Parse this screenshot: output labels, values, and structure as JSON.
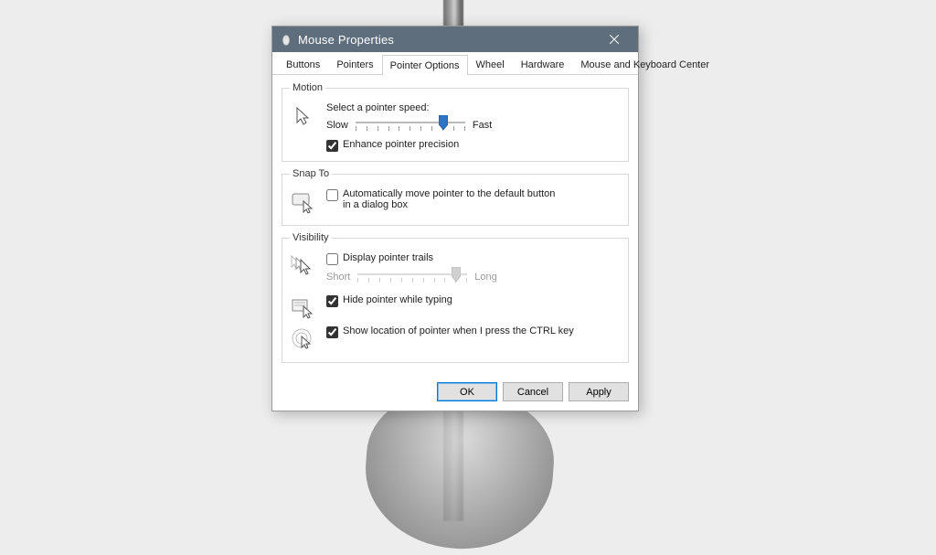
{
  "window": {
    "title": "Mouse Properties"
  },
  "tabs": [
    {
      "label": "Buttons"
    },
    {
      "label": "Pointers"
    },
    {
      "label": "Pointer Options"
    },
    {
      "label": "Wheel"
    },
    {
      "label": "Hardware"
    },
    {
      "label": "Mouse and Keyboard Center"
    }
  ],
  "activeTabIndex": 2,
  "motion": {
    "legend": "Motion",
    "prompt": "Select a pointer speed:",
    "slow": "Slow",
    "fast": "Fast",
    "speed_value": 8,
    "speed_ticks": 11,
    "enhance_label": "Enhance pointer precision",
    "enhance_checked": true
  },
  "snap": {
    "legend": "Snap To",
    "auto_label": "Automatically move pointer to the default button in a dialog box",
    "auto_checked": false
  },
  "visibility": {
    "legend": "Visibility",
    "trails_label": "Display pointer trails",
    "trails_checked": false,
    "short": "Short",
    "long": "Long",
    "trails_value": 9,
    "trails_ticks": 11,
    "hide_label": "Hide pointer while typing",
    "hide_checked": true,
    "ctrl_label": "Show location of pointer when I press the CTRL key",
    "ctrl_checked": true
  },
  "buttons": {
    "ok": "OK",
    "cancel": "Cancel",
    "apply": "Apply"
  }
}
